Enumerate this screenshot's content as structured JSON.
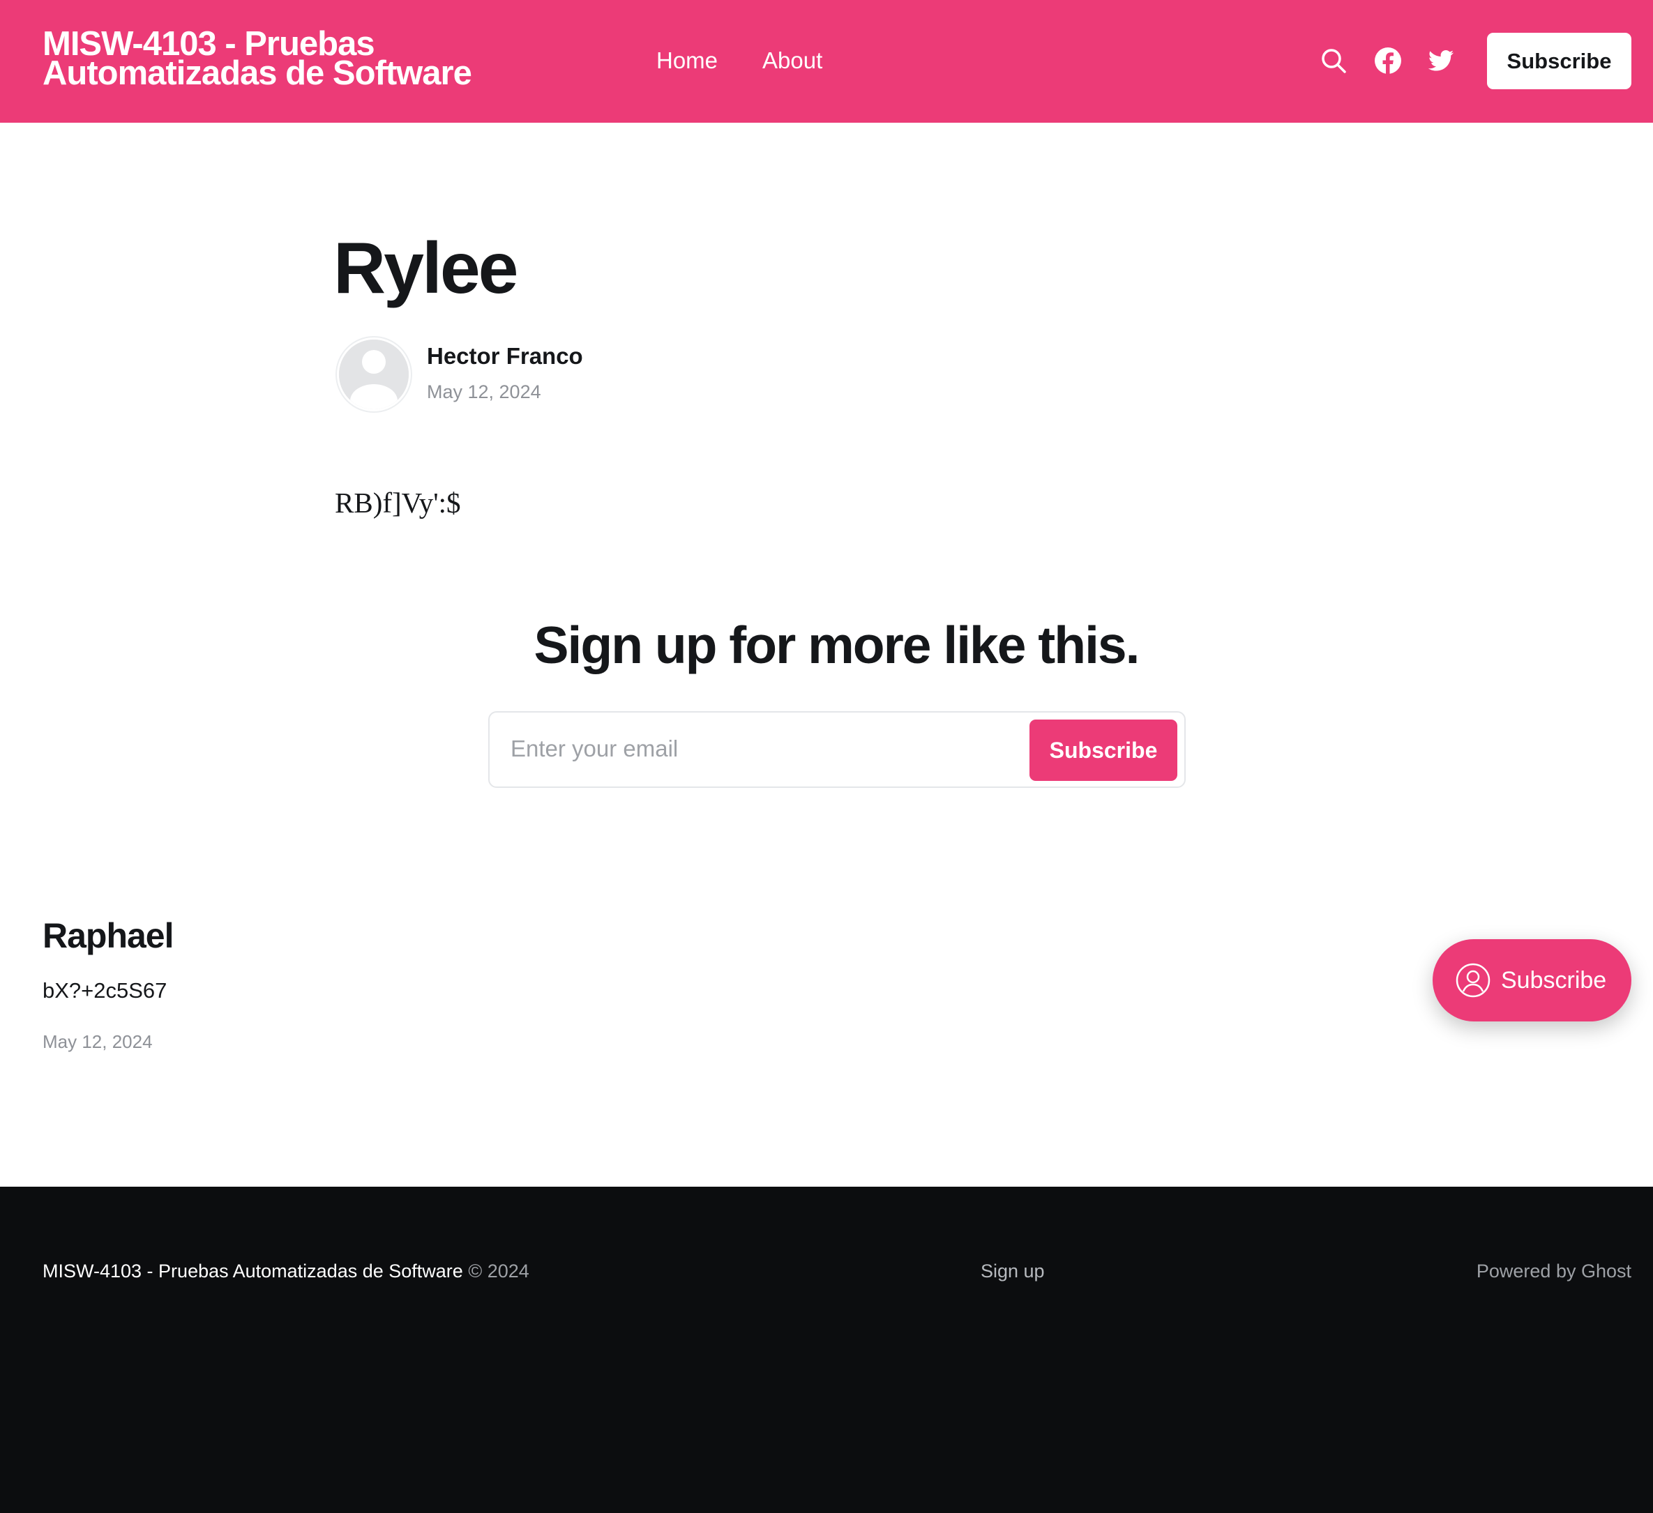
{
  "header": {
    "site_title": "MISW-4103 - Pruebas Automatizadas de Software",
    "nav": [
      {
        "label": "Home"
      },
      {
        "label": "About"
      }
    ],
    "icons": [
      "search-icon",
      "facebook-icon",
      "twitter-icon"
    ],
    "subscribe_label": "Subscribe",
    "accent_color": "#ec3b77"
  },
  "post": {
    "title": "Rylee",
    "author": "Hector Franco",
    "date": "May 12, 2024",
    "body": "RB)f]Vy':$"
  },
  "cta": {
    "heading": "Sign up for more like this.",
    "email_placeholder": "Enter your email",
    "button_label": "Subscribe"
  },
  "related": {
    "title": "Raphael",
    "excerpt": "bX?+2c5S67",
    "date": "May 12, 2024"
  },
  "portal": {
    "label": "Subscribe",
    "icon": "user-circle-icon"
  },
  "footer": {
    "site_name": "MISW-4103 - Pruebas Automatizadas de Software",
    "copyright": "© 2024",
    "signup_label": "Sign up",
    "powered_by": "Powered by Ghost",
    "background_color": "#0c0d0f"
  }
}
